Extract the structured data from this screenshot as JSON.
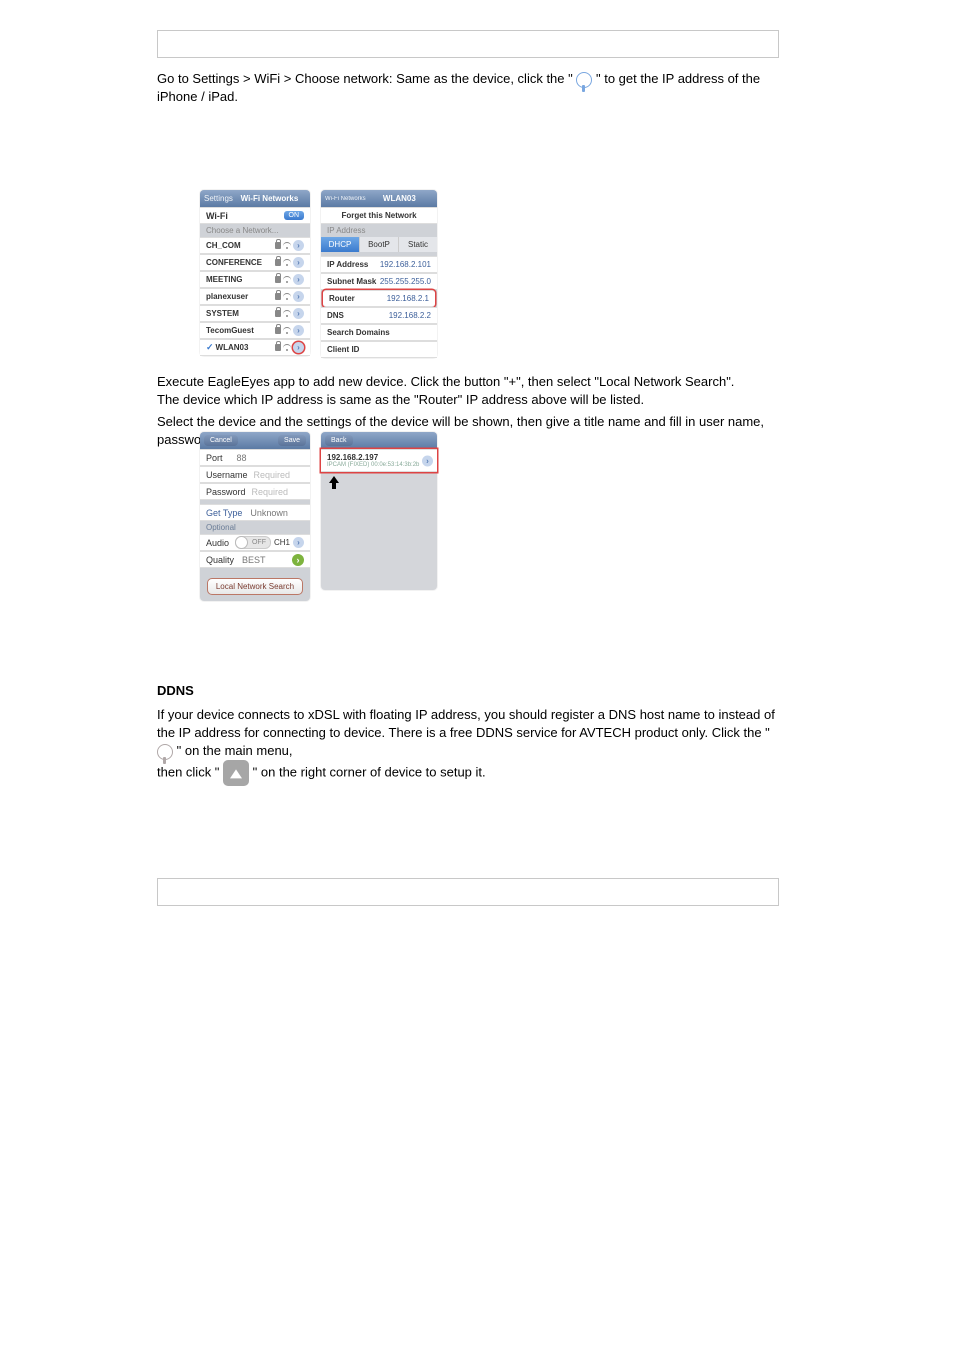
{
  "intro": {
    "line1_prefix": "Go to Settings > WiFi > Choose network: Same as the device, click the \"",
    "line1_suffix": "\" to get the IP address of the iPhone / iPad."
  },
  "wifi_panel": {
    "nav_back": "Settings",
    "nav_title": "Wi-Fi Networks",
    "wifi_label": "Wi-Fi",
    "wifi_state": "ON",
    "choose_label": "Choose a Network...",
    "networks": [
      "CH_COM",
      "CONFERENCE",
      "MEETING",
      "planexuser",
      "SYSTEM",
      "TecomGuest",
      "WLAN03"
    ],
    "checked_index": 6
  },
  "detail_panel": {
    "nav_back": "Wi-Fi Networks",
    "nav_title": "WLAN03",
    "forget": "Forget this Network",
    "section_ip": "IP Address",
    "tabs": [
      "DHCP",
      "BootP",
      "Static"
    ],
    "rows": [
      {
        "label": "IP Address",
        "value": "192.168.2.101"
      },
      {
        "label": "Subnet Mask",
        "value": "255.255.255.0"
      },
      {
        "label": "Router",
        "value": "192.168.2.1"
      },
      {
        "label": "DNS",
        "value": "192.168.2.2"
      },
      {
        "label": "Search Domains",
        "value": ""
      },
      {
        "label": "Client ID",
        "value": ""
      }
    ],
    "highlight_index": 2
  },
  "midtext": {
    "p1_a": "Execute EagleEyes app to add new device. Click the button \"+\", then select \"Local Network Search\".",
    "p1_b": "The device which IP address is same as the \"Router\" IP address above will be listed.",
    "p2": "Select the device and the settings of the device will be shown, then give a title name and fill in user name, password to save it."
  },
  "edit_panel": {
    "nav_left": "Cancel",
    "nav_right": "Save",
    "rows": {
      "port_label": "Port",
      "port_value": "88",
      "user_label": "Username",
      "user_ph": "Required",
      "pass_label": "Password",
      "pass_ph": "Required",
      "get_label": "Get Type",
      "get_value": "Unknown",
      "optional_label": "Optional",
      "audio_label": "Audio",
      "audio_state": "OFF",
      "audio_ch": "CH1",
      "quality_label": "Quality",
      "quality_value": "BEST"
    },
    "lns": "Local Network Search"
  },
  "search_panel": {
    "nav_left": "Back",
    "entry_ip": "192.168.2.197",
    "entry_sub": "IPCAM (FIXED)   00:0e:53:14:3b:2b"
  },
  "ddns": {
    "title": "DDNS",
    "l1_a": "If your device connects to xDSL with floating IP address, you should register a DNS host name to instead of the IP address for connecting to device.",
    "l1_b": "There is a free DDNS service for AVTECH product only. Click the \" ",
    "l1_c": "\" on the main menu,",
    "l2_prefix": "then click \"",
    "l2_suffix": "\" on the right corner of device to setup it."
  },
  "air_icon_name": "paper-plane-icon"
}
